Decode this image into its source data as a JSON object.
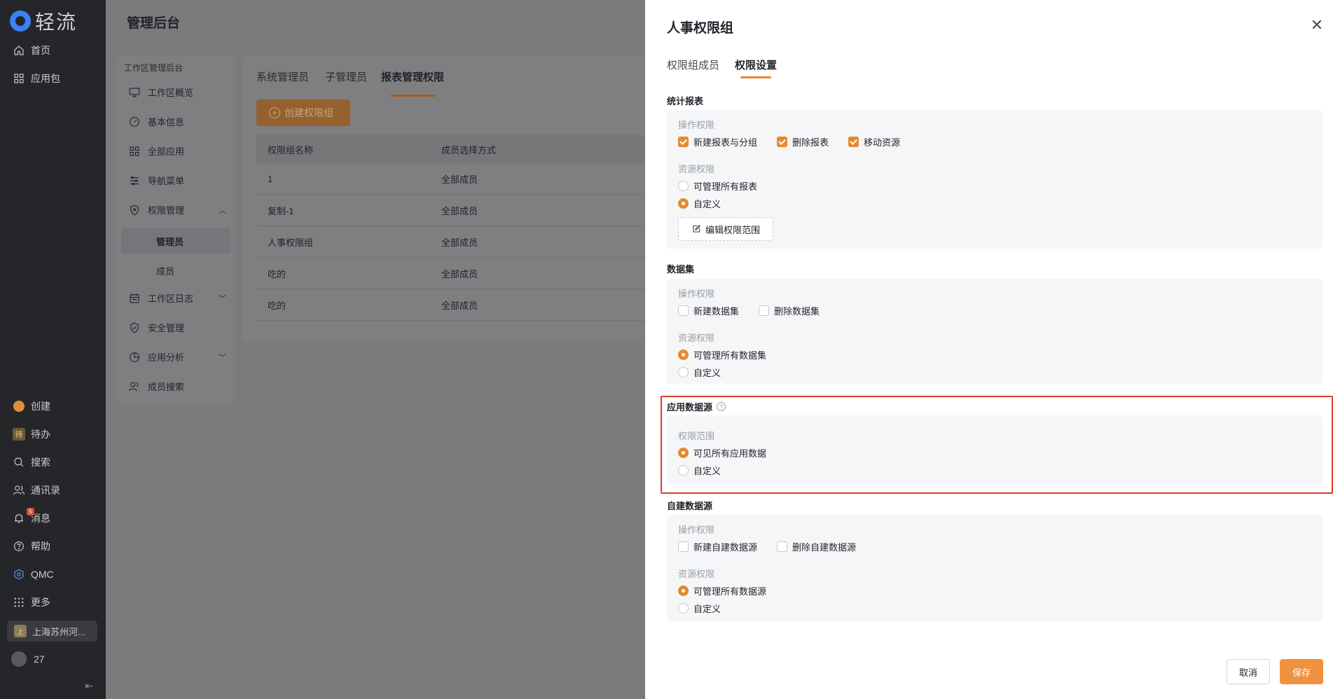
{
  "nav": {
    "logo_text": "轻流",
    "top_items": [
      {
        "label": "首页",
        "icon": "home-icon"
      },
      {
        "label": "应用包",
        "icon": "grid-icon"
      }
    ],
    "bottom_items": [
      {
        "label": "创建",
        "icon": "create-icon"
      },
      {
        "label": "待办",
        "icon": "todo-icon",
        "icon_text": "待"
      },
      {
        "label": "搜索",
        "icon": "search-icon"
      },
      {
        "label": "通讯录",
        "icon": "contacts-icon"
      },
      {
        "label": "消息",
        "icon": "bell-icon",
        "badge": "5"
      },
      {
        "label": "帮助",
        "icon": "help-icon"
      },
      {
        "label": "QMC",
        "icon": "qmc-icon"
      },
      {
        "label": "更多",
        "icon": "more-icon"
      }
    ],
    "org": {
      "label": "上海苏州河...",
      "icon_text": "上"
    },
    "user": {
      "label": "27"
    },
    "collapse_glyph": "⇤"
  },
  "main": {
    "title": "管理后台",
    "sidebar": {
      "header": "工作区管理后台",
      "items": [
        {
          "label": "工作区概览"
        },
        {
          "label": "基本信息"
        },
        {
          "label": "全部应用"
        },
        {
          "label": "导航菜单"
        },
        {
          "label": "权限管理"
        },
        {
          "label": "管理员"
        },
        {
          "label": "成员"
        },
        {
          "label": "工作区日志"
        },
        {
          "label": "安全管理"
        },
        {
          "label": "应用分析"
        },
        {
          "label": "成员搜索"
        }
      ]
    },
    "tabs": [
      {
        "label": "系统管理员"
      },
      {
        "label": "子管理员"
      },
      {
        "label": "报表管理权限"
      }
    ],
    "create_button": "创建权限组",
    "table": {
      "columns": [
        "权限组名称",
        "成员选择方式"
      ],
      "rows": [
        [
          "1",
          "全部成员"
        ],
        [
          "复制-1",
          "全部成员"
        ],
        [
          "人事权限组",
          "全部成员"
        ],
        [
          "吃的",
          "全部成员"
        ],
        [
          "吃的",
          "全部成员"
        ]
      ]
    }
  },
  "drawer": {
    "title": "人事权限组",
    "close_glyph": "✕",
    "tabs": [
      {
        "label": "权限组成员"
      },
      {
        "label": "权限设置"
      }
    ],
    "sections": {
      "reports": {
        "title": "统计报表",
        "op_label": "操作权限",
        "ops": [
          {
            "label": "新建报表与分组",
            "checked": true
          },
          {
            "label": "删除报表",
            "checked": true
          },
          {
            "label": "移动资源",
            "checked": true
          }
        ],
        "res_label": "资源权限",
        "res": [
          {
            "label": "可管理所有报表",
            "selected": false
          },
          {
            "label": "自定义",
            "selected": true
          }
        ],
        "edit_button": "编辑权限范围"
      },
      "datasets": {
        "title": "数据集",
        "op_label": "操作权限",
        "ops": [
          {
            "label": "新建数据集",
            "checked": false
          },
          {
            "label": "删除数据集",
            "checked": false
          }
        ],
        "res_label": "资源权限",
        "res": [
          {
            "label": "可管理所有数据集",
            "selected": true
          },
          {
            "label": "自定义",
            "selected": false
          }
        ]
      },
      "app_source": {
        "title": "应用数据源",
        "help_glyph": "?",
        "scope_label": "权限范围",
        "res": [
          {
            "label": "可见所有应用数据",
            "selected": true
          },
          {
            "label": "自定义",
            "selected": false
          }
        ]
      },
      "custom_source": {
        "title": "自建数据源",
        "op_label": "操作权限",
        "ops": [
          {
            "label": "新建自建数据源",
            "checked": false
          },
          {
            "label": "删除自建数据源",
            "checked": false
          }
        ],
        "res_label": "资源权限",
        "res": [
          {
            "label": "可管理所有数据源",
            "selected": true
          },
          {
            "label": "自定义",
            "selected": false
          }
        ]
      }
    },
    "cancel_label": "取消",
    "save_label": "保存"
  },
  "colors": {
    "accent": "#e8892d",
    "highlight_border": "#e03a2a",
    "nav_bg": "#25262a"
  }
}
